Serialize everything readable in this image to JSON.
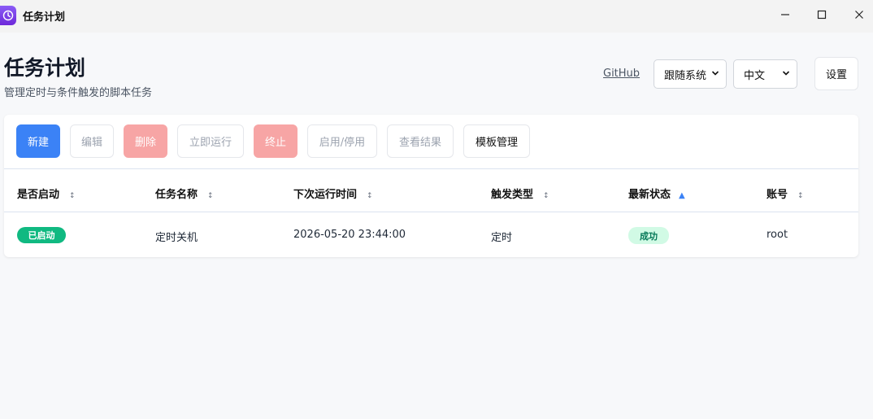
{
  "window": {
    "title": "任务计划",
    "controls": {
      "minimize": "—",
      "maximize": "☐",
      "close": "✕"
    }
  },
  "header": {
    "title": "任务计划",
    "subtitle": "管理定时与条件触发的脚本任务",
    "github_label": "GitHub",
    "theme_select": {
      "value": "跟随系统"
    },
    "lang_select": {
      "value": "中文"
    },
    "settings_label": "设置"
  },
  "toolbar": {
    "new_label": "新建",
    "edit_label": "编辑",
    "delete_label": "删除",
    "run_now_label": "立即运行",
    "stop_label": "终止",
    "toggle_label": "启用/停用",
    "results_label": "查看结果",
    "templates_label": "模板管理"
  },
  "table": {
    "columns": [
      "是否启动",
      "任务名称",
      "下次运行时间",
      "触发类型",
      "最新状态",
      "账号"
    ],
    "sort_column": "最新状态",
    "sort_direction": "asc",
    "rows": [
      {
        "enabled": "已启动",
        "name": "定时关机",
        "next_run": "2026-05-20 23:44:00",
        "trigger": "定时",
        "status": "成功",
        "account": "root"
      }
    ]
  },
  "colors": {
    "primary": "#3b82f6",
    "danger_disabled": "#f7a5a5",
    "enabled_badge": "#10b981",
    "success_badge_bg": "#d1fae5",
    "success_badge_text": "#047857",
    "app_icon": "#7c3aed"
  },
  "icons": {
    "app": "clock-icon",
    "sort": "sort-arrows-icon",
    "sort_active": "triangle-up-icon",
    "select": "chevron-down-icon"
  }
}
